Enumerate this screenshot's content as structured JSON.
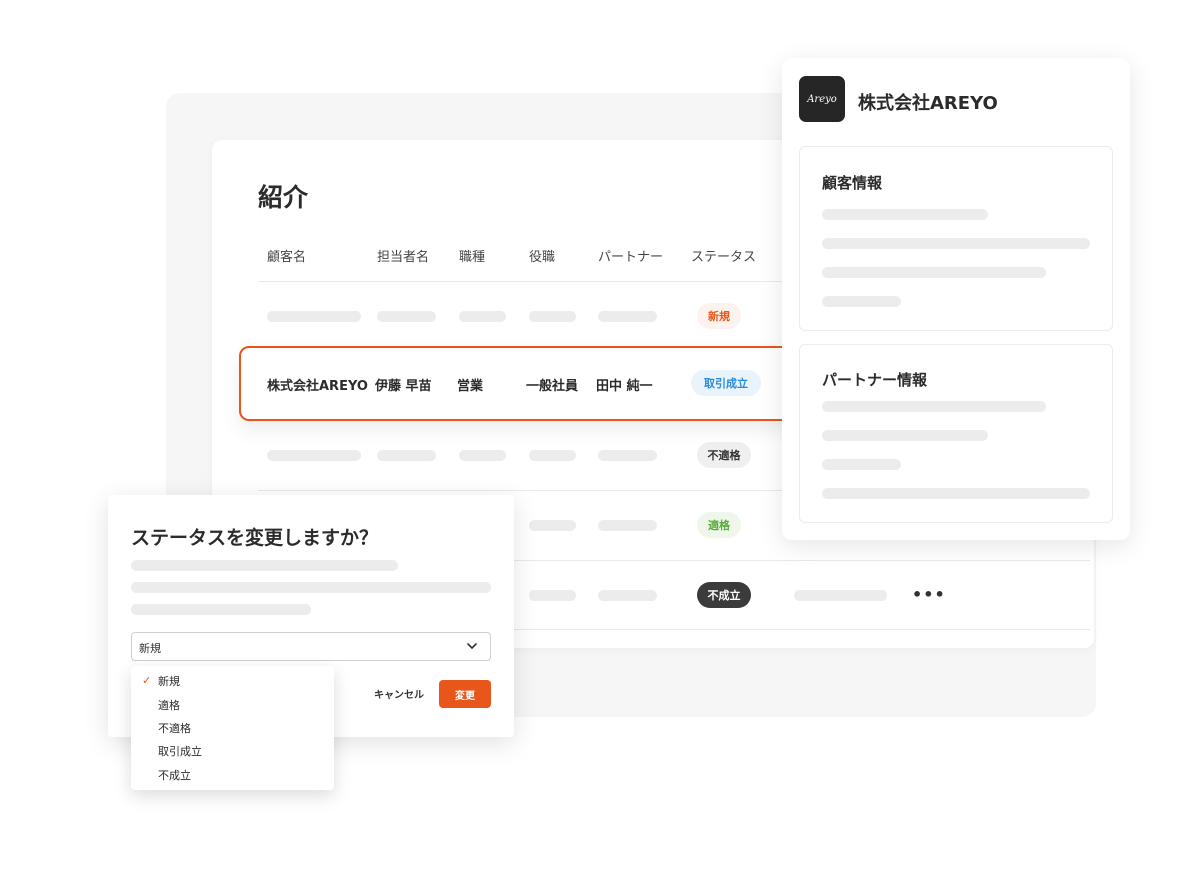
{
  "main": {
    "title": "紹介",
    "columns": [
      "顧客名",
      "担当者名",
      "職種",
      "役職",
      "パートナー",
      "ステータス"
    ],
    "highlighted_row": {
      "customer": "株式会社AREYO",
      "person": "伊藤 早苗",
      "job": "営業",
      "position": "一般社員",
      "partner": "田中 純一",
      "status": "取引成立"
    },
    "status_badges": [
      "新規",
      "不適格",
      "適格",
      "不成立"
    ],
    "more_icon": "•••"
  },
  "side_panel": {
    "logo_text": "Areyo",
    "company": "株式会社AREYO",
    "customer_info_title": "顧客情報",
    "partner_info_title": "パートナー情報"
  },
  "dialog": {
    "title": "ステータスを変更しますか？",
    "select_value": "新規",
    "cancel_label": "キャンセル",
    "confirm_label": "変更",
    "options": [
      "新規",
      "適格",
      "不適格",
      "取引成立",
      "不成立"
    ],
    "checked_icon": "✓"
  },
  "colors": {
    "accent": "#e8561b",
    "deal_blue": "#2b8ad8",
    "fit_green": "#5aac3b",
    "fail_dark": "#3b3b3b"
  }
}
